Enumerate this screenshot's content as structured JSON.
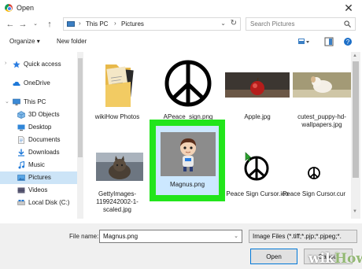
{
  "window": {
    "title": "Open"
  },
  "address": {
    "crumbs": [
      "This PC",
      "Pictures"
    ]
  },
  "search": {
    "placeholder": "Search Pictures"
  },
  "toolbar": {
    "organize_label": "Organize",
    "new_folder_label": "New folder"
  },
  "sidebar": {
    "items": [
      {
        "label": "Quick access",
        "icon": "star-icon"
      },
      {
        "label": "OneDrive",
        "icon": "cloud-icon"
      },
      {
        "label": "This PC",
        "icon": "computer-icon"
      },
      {
        "label": "3D Objects",
        "icon": "cube-icon"
      },
      {
        "label": "Desktop",
        "icon": "desktop-icon"
      },
      {
        "label": "Documents",
        "icon": "documents-icon"
      },
      {
        "label": "Downloads",
        "icon": "download-icon"
      },
      {
        "label": "Music",
        "icon": "music-icon"
      },
      {
        "label": "Pictures",
        "icon": "pictures-icon",
        "selected": true
      },
      {
        "label": "Videos",
        "icon": "videos-icon"
      },
      {
        "label": "Local Disk (C:)",
        "icon": "drive-icon"
      }
    ]
  },
  "files": [
    {
      "name": "wikiHow Photos",
      "kind": "folder"
    },
    {
      "name": "APeace_sign.png",
      "kind": "peace-image"
    },
    {
      "name": "Apple.jpg",
      "kind": "apple-photo"
    },
    {
      "name": "cutest_puppy-hd-wallpapers.jpg",
      "kind": "puppy-photo"
    },
    {
      "name": "GettyImages-1199242002-1-scaled.jpg",
      "kind": "cat-photo"
    },
    {
      "name": "Magnus.png",
      "kind": "magnus-image",
      "selected": true
    },
    {
      "name": "Peace Sign Cursor.ico",
      "kind": "peace-cursor-ico"
    },
    {
      "name": "Peace Sign Cursor.cur",
      "kind": "peace-cursor-cur"
    }
  ],
  "bottom": {
    "file_name_label": "File name:",
    "file_name_value": "Magnus.png",
    "file_type_value": "Image Files (*.tiff;*.pjp;*.pjpeg;*.",
    "open_label": "Open",
    "cancel_label": "Cancel"
  },
  "highlight_color": "#22e51b",
  "watermark": {
    "wiki": "wiki",
    "how": "How"
  }
}
